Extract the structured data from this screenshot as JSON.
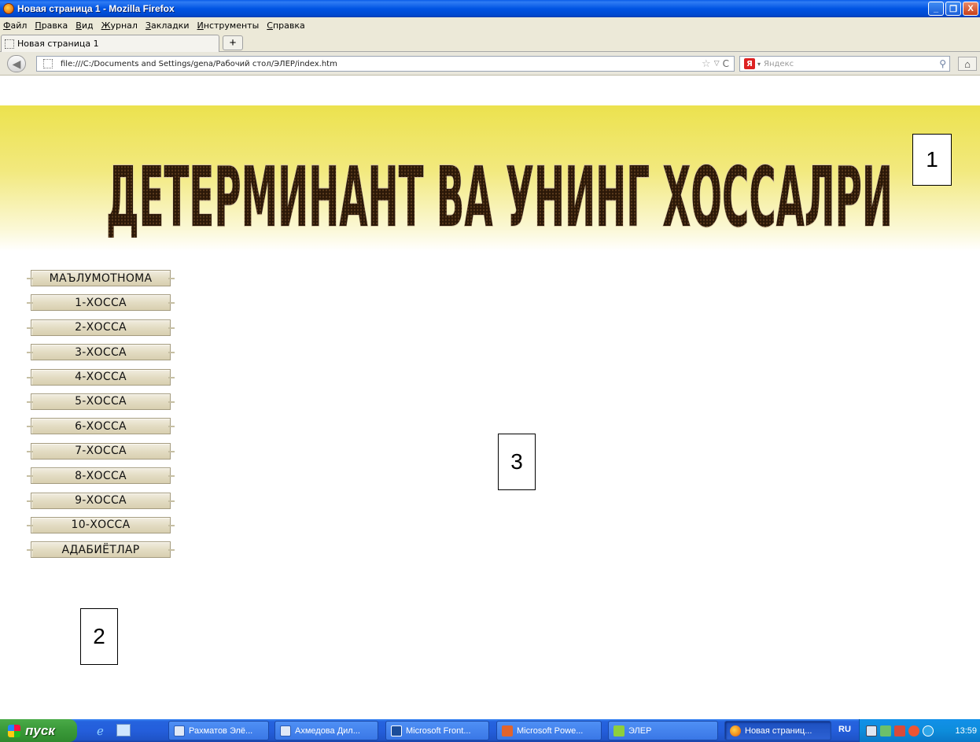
{
  "window": {
    "title": "Новая страница 1 - Mozilla Firefox",
    "controls": {
      "minimize": "_",
      "maximize": "❐",
      "close": "X"
    }
  },
  "menubar": {
    "items": [
      "Файл",
      "Правка",
      "Вид",
      "Журнал",
      "Закладки",
      "Инструменты",
      "Справка"
    ]
  },
  "tabs": {
    "active_tab": "Новая страница 1",
    "new_tab_label": "+"
  },
  "navbar": {
    "url": "file:///C:/Documents and Settings/gena/Рабочий стол/ЭЛЕР/index.htm",
    "search_placeholder": "Яндекс",
    "search_engine_icon": "Я"
  },
  "page": {
    "banner_title": "ДЕТЕРМИНАНТ ВА УНИНГ ХОССАЛРИ",
    "box_labels": {
      "banner": "1",
      "menu": "2",
      "content": "3"
    },
    "menu_buttons": [
      "МАЪЛУМОТНОМА",
      "1-ХОССА",
      "2-ХОССА",
      "3-ХОССА",
      "4-ХОССА",
      "5-ХОССА",
      "6-ХОССА",
      "7-ХОССА",
      "8-ХОССА",
      "9-ХОССА",
      "10-ХОССА",
      "АДАБИЁТЛАР"
    ]
  },
  "taskbar": {
    "start_label": "пуск",
    "buttons": [
      "Рахматов Элё...",
      "Ахмедова Дил...",
      "Microsoft Front...",
      "Microsoft Powe...",
      "ЭЛЕР",
      "Новая страниц..."
    ],
    "language": "RU",
    "clock": "13:59"
  },
  "colors": {
    "title_bar": "#0054e3",
    "banner_yellow": "#ece24e",
    "taskbar_blue": "#245edb",
    "start_green": "#3c9c3b"
  }
}
